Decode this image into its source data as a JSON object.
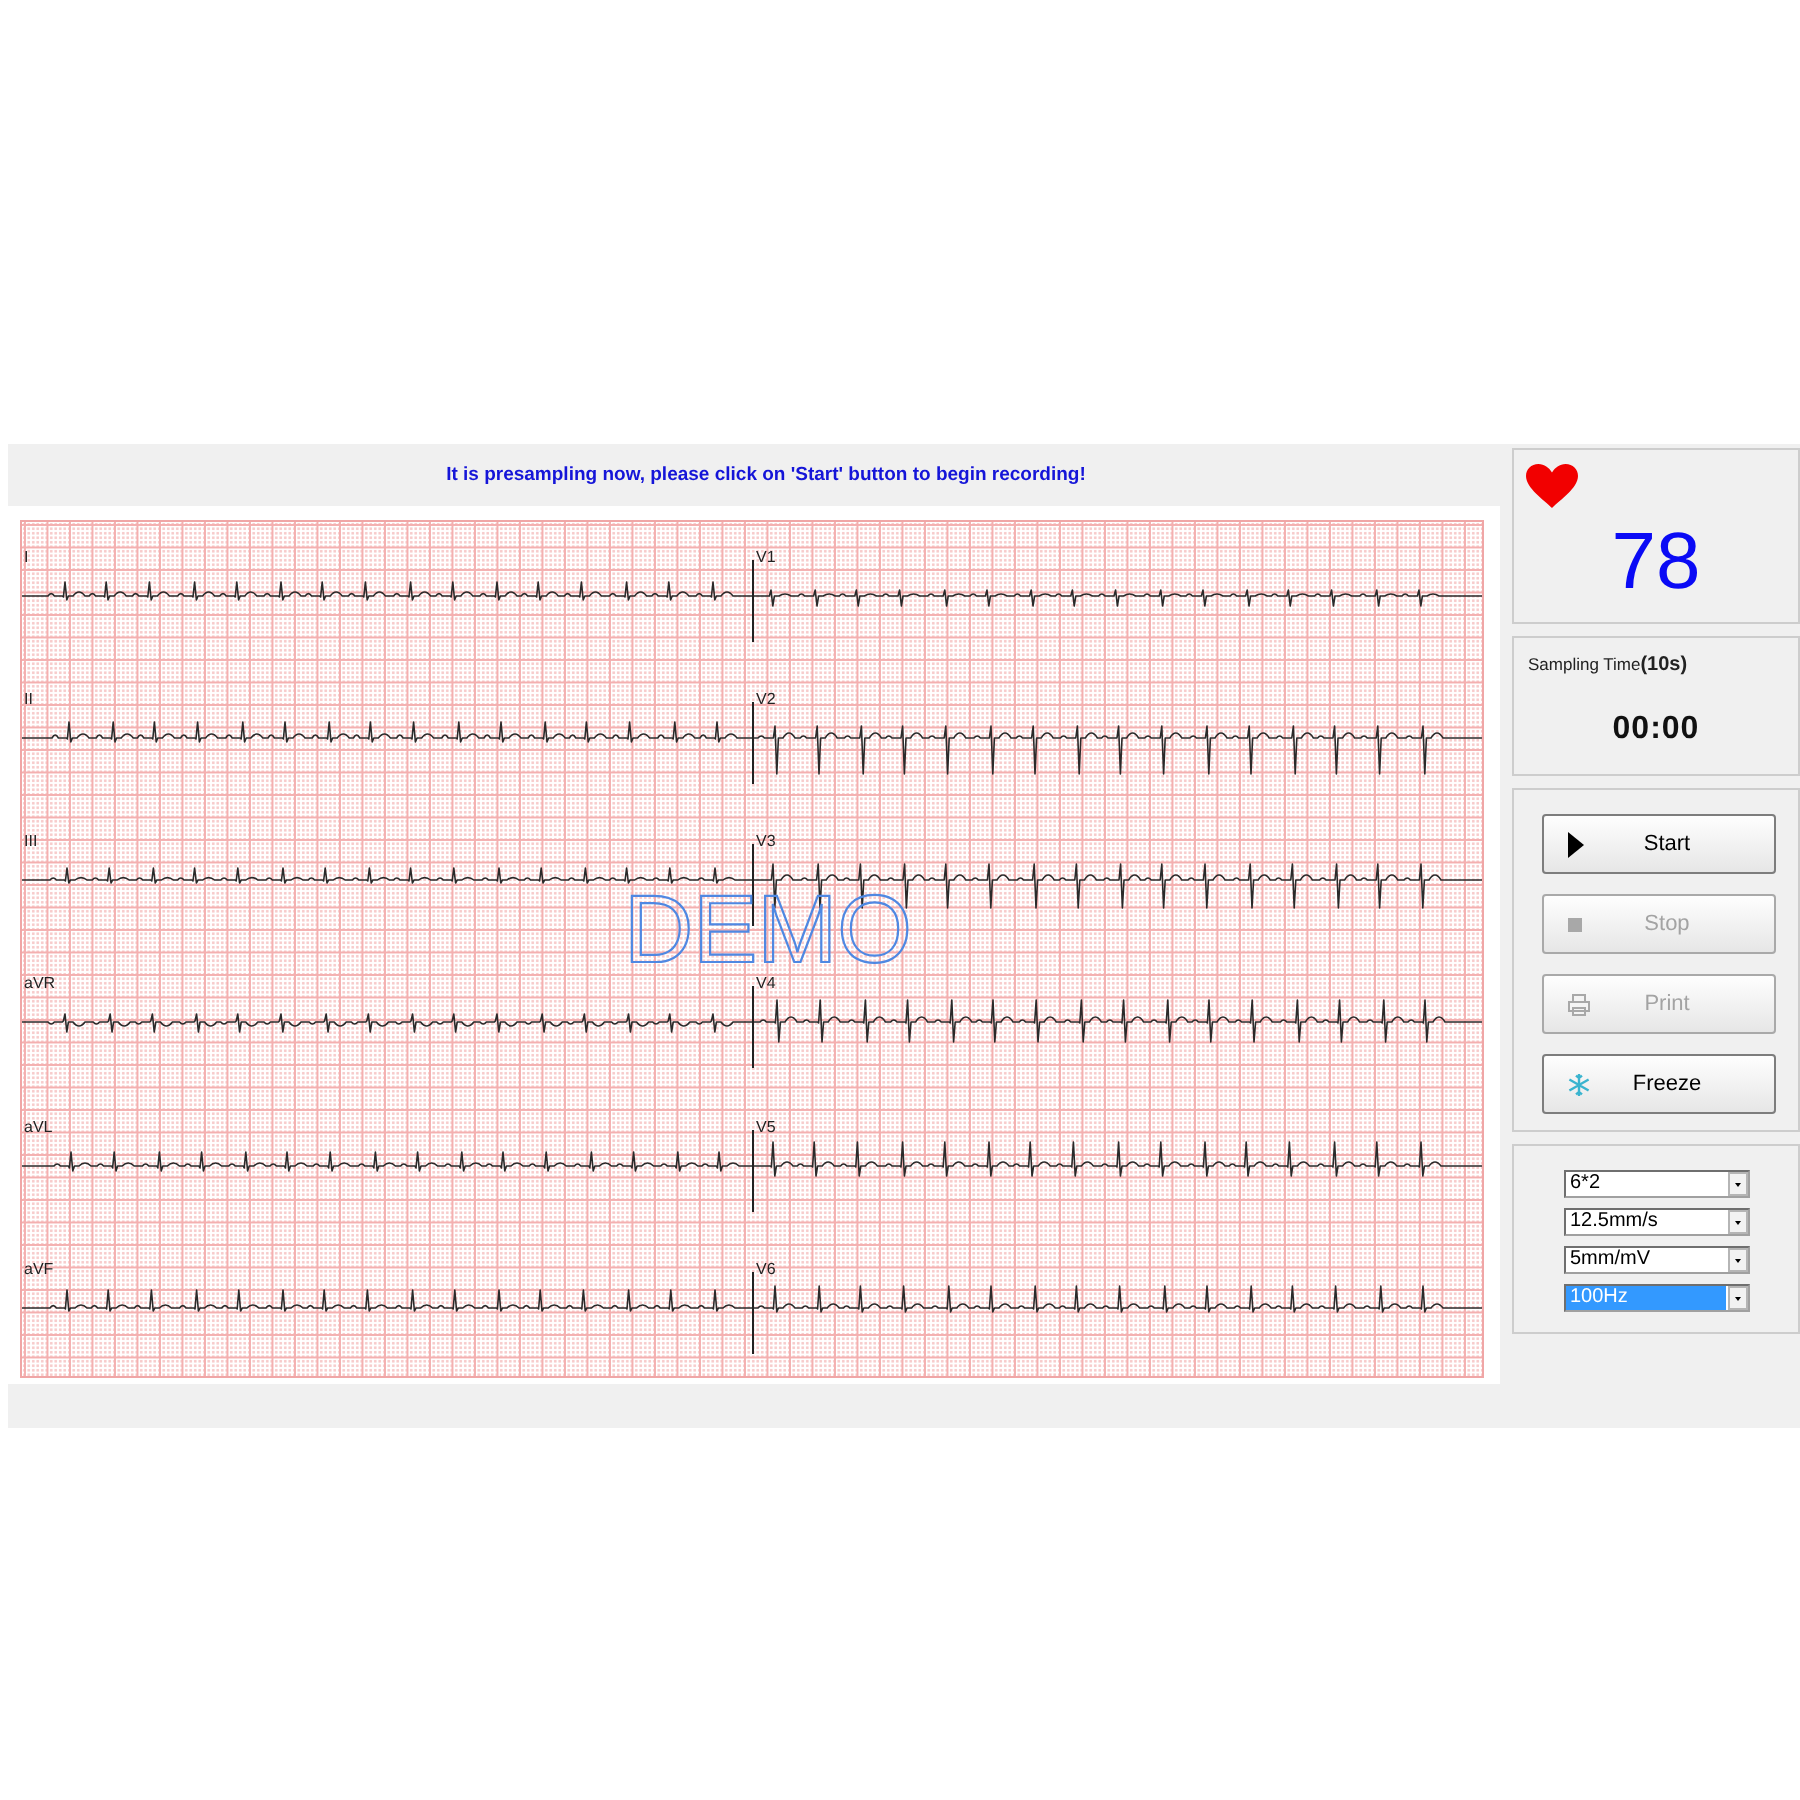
{
  "status_message": "It is presampling now, please click on 'Start' button to begin recording!",
  "ecg": {
    "rows": [
      {
        "left_lead": "I",
        "right_lead": "V1"
      },
      {
        "left_lead": "II",
        "right_lead": "V2"
      },
      {
        "left_lead": "III",
        "right_lead": "V3"
      },
      {
        "left_lead": "aVR",
        "right_lead": "V4"
      },
      {
        "left_lead": "aVL",
        "right_lead": "V5"
      },
      {
        "left_lead": "aVF",
        "right_lead": "V6"
      }
    ],
    "overlay_text": "DEMO"
  },
  "heart_rate": {
    "value": "78"
  },
  "sampling": {
    "label": "Sampling Time**(10s)**",
    "time": "00:00"
  },
  "buttons": [
    {
      "kind": "start",
      "label": "Start",
      "disabled": false
    },
    {
      "kind": "stop",
      "label": "Stop",
      "disabled": true
    },
    {
      "kind": "print",
      "label": "Print",
      "disabled": true
    },
    {
      "kind": "freeze",
      "label": "Freeze",
      "disabled": false
    }
  ],
  "settings": [
    {
      "value": "6*2",
      "selected": false
    },
    {
      "value": "12.5mm/s",
      "selected": false
    },
    {
      "value": "5mm/mV",
      "selected": false
    },
    {
      "value": "100Hz",
      "selected": true
    }
  ]
}
